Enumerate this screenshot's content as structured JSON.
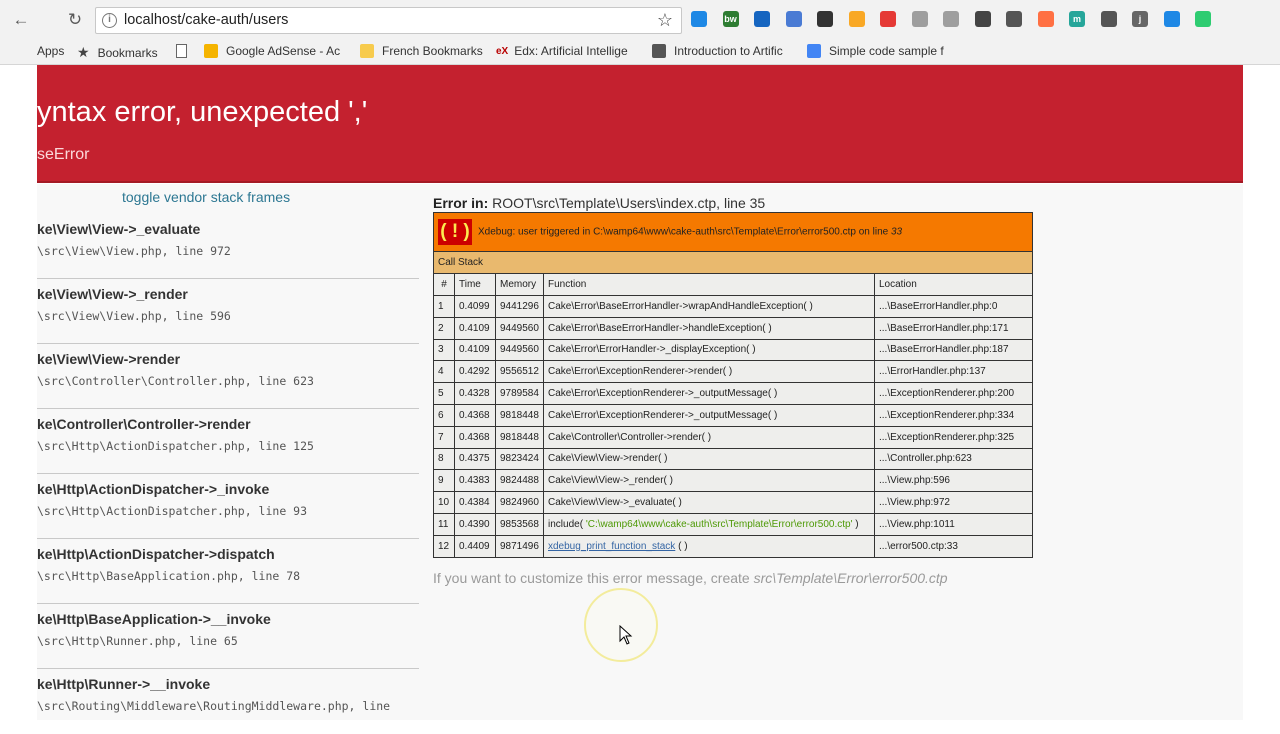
{
  "browser": {
    "url": "localhost/cake-auth/users",
    "bookmarks": [
      {
        "label": "Apps",
        "color": "#4285f4"
      },
      {
        "label": "Bookmarks",
        "color": "#444444"
      },
      {
        "label": "Google AdSense - Ac",
        "color": "#f5b400"
      },
      {
        "label": "French Bookmarks",
        "color": "#f7cb4d"
      },
      {
        "label": "Edx: Artificial Intellige",
        "color": "#b80000"
      },
      {
        "label": "Introduction to Artific",
        "color": "#555555"
      },
      {
        "label": "Simple code sample f",
        "color": "#4285f4"
      }
    ],
    "extensions": [
      {
        "label": "",
        "color": "#1e88e5"
      },
      {
        "label": "bw",
        "color": "#2e7d32"
      },
      {
        "label": "",
        "color": "#1565c0"
      },
      {
        "label": "",
        "color": "#4a7bd4"
      },
      {
        "label": "",
        "color": "#333333"
      },
      {
        "label": "",
        "color": "#f9a825"
      },
      {
        "label": "",
        "color": "#e53935"
      },
      {
        "label": "",
        "color": "#9e9e9e"
      },
      {
        "label": "",
        "color": "#9e9e9e"
      },
      {
        "label": "",
        "color": "#444444"
      },
      {
        "label": "",
        "color": "#555555"
      },
      {
        "label": "",
        "color": "#ff7043"
      },
      {
        "label": "m",
        "color": "#26a69a"
      },
      {
        "label": "",
        "color": "#555555"
      },
      {
        "label": "j",
        "color": "#666666"
      },
      {
        "label": "",
        "color": "#1e88e5"
      },
      {
        "label": "",
        "color": "#2ecc71"
      }
    ]
  },
  "header": {
    "title": "yntax error, unexpected ','",
    "type": "seError"
  },
  "sidebar": {
    "toggle_label": "toggle vendor stack frames",
    "frames": [
      {
        "fn": "ke\\View\\View->_evaluate",
        "file": "\\src\\View\\View.php, line 972"
      },
      {
        "fn": "ke\\View\\View->_render",
        "file": "\\src\\View\\View.php, line 596"
      },
      {
        "fn": "ke\\View\\View->render",
        "file": "\\src\\Controller\\Controller.php, line 623"
      },
      {
        "fn": "ke\\Controller\\Controller->render",
        "file": "\\src\\Http\\ActionDispatcher.php, line 125"
      },
      {
        "fn": "ke\\Http\\ActionDispatcher->_invoke",
        "file": "\\src\\Http\\ActionDispatcher.php, line 93"
      },
      {
        "fn": "ke\\Http\\ActionDispatcher->dispatch",
        "file": "\\src\\Http\\BaseApplication.php, line 78"
      },
      {
        "fn": "ke\\Http\\BaseApplication->__invoke",
        "file": "\\src\\Http\\Runner.php, line 65"
      },
      {
        "fn": "ke\\Http\\Runner->__invoke",
        "file": "\\src\\Routing\\Middleware\\RoutingMiddleware.php, line"
      }
    ]
  },
  "main": {
    "error_in_label": "Error in:",
    "error_in_path": "ROOT\\src\\Template\\Users\\index.ctp, line 35",
    "xdebug": {
      "bang": "( ! )",
      "message": "Xdebug: user triggered in C:\\wamp64\\www\\cake-auth\\src\\Template\\Error\\error500.ctp on line",
      "message_line": "33",
      "call_stack_label": "Call Stack",
      "columns": [
        "#",
        "Time",
        "Memory",
        "Function",
        "Location"
      ],
      "rows": [
        {
          "n": "1",
          "time": "0.4099",
          "mem": "9441296",
          "fn": "Cake\\Error\\BaseErrorHandler->wrapAndHandleException( )",
          "loc": "...\\BaseErrorHandler.php:0"
        },
        {
          "n": "2",
          "time": "0.4109",
          "mem": "9449560",
          "fn": "Cake\\Error\\BaseErrorHandler->handleException( )",
          "loc": "...\\BaseErrorHandler.php:171"
        },
        {
          "n": "3",
          "time": "0.4109",
          "mem": "9449560",
          "fn": "Cake\\Error\\ErrorHandler->_displayException( )",
          "loc": "...\\BaseErrorHandler.php:187"
        },
        {
          "n": "4",
          "time": "0.4292",
          "mem": "9556512",
          "fn": "Cake\\Error\\ExceptionRenderer->render( )",
          "loc": "...\\ErrorHandler.php:137"
        },
        {
          "n": "5",
          "time": "0.4328",
          "mem": "9789584",
          "fn": "Cake\\Error\\ExceptionRenderer->_outputMessage( )",
          "loc": "...\\ExceptionRenderer.php:200"
        },
        {
          "n": "6",
          "time": "0.4368",
          "mem": "9818448",
          "fn": "Cake\\Error\\ExceptionRenderer->_outputMessage( )",
          "loc": "...\\ExceptionRenderer.php:334"
        },
        {
          "n": "7",
          "time": "0.4368",
          "mem": "9818448",
          "fn": "Cake\\Controller\\Controller->render( )",
          "loc": "...\\ExceptionRenderer.php:325"
        },
        {
          "n": "8",
          "time": "0.4375",
          "mem": "9823424",
          "fn": "Cake\\View\\View->render( )",
          "loc": "...\\Controller.php:623"
        },
        {
          "n": "9",
          "time": "0.4383",
          "mem": "9824488",
          "fn": "Cake\\View\\View->_render( )",
          "loc": "...\\View.php:596"
        },
        {
          "n": "10",
          "time": "0.4384",
          "mem": "9824960",
          "fn": "Cake\\View\\View->_evaluate( )",
          "loc": "...\\View.php:972"
        },
        {
          "n": "11",
          "time": "0.4390",
          "mem": "9853568",
          "fn_prefix": "include( ",
          "fn_str": "'C:\\wamp64\\www\\cake-auth\\src\\Template\\Error\\error500.ctp'",
          "fn_suffix": " )",
          "loc": "...\\View.php:1011"
        },
        {
          "n": "12",
          "time": "0.4409",
          "mem": "9871496",
          "fn_link": "xdebug_print_function_stack",
          "fn_suffix": " ( )",
          "loc": "...\\error500.ctp:33"
        }
      ]
    },
    "customize_prefix": "If you want to customize this error message, create",
    "customize_path": "src\\Template\\Error\\error500.ctp"
  }
}
